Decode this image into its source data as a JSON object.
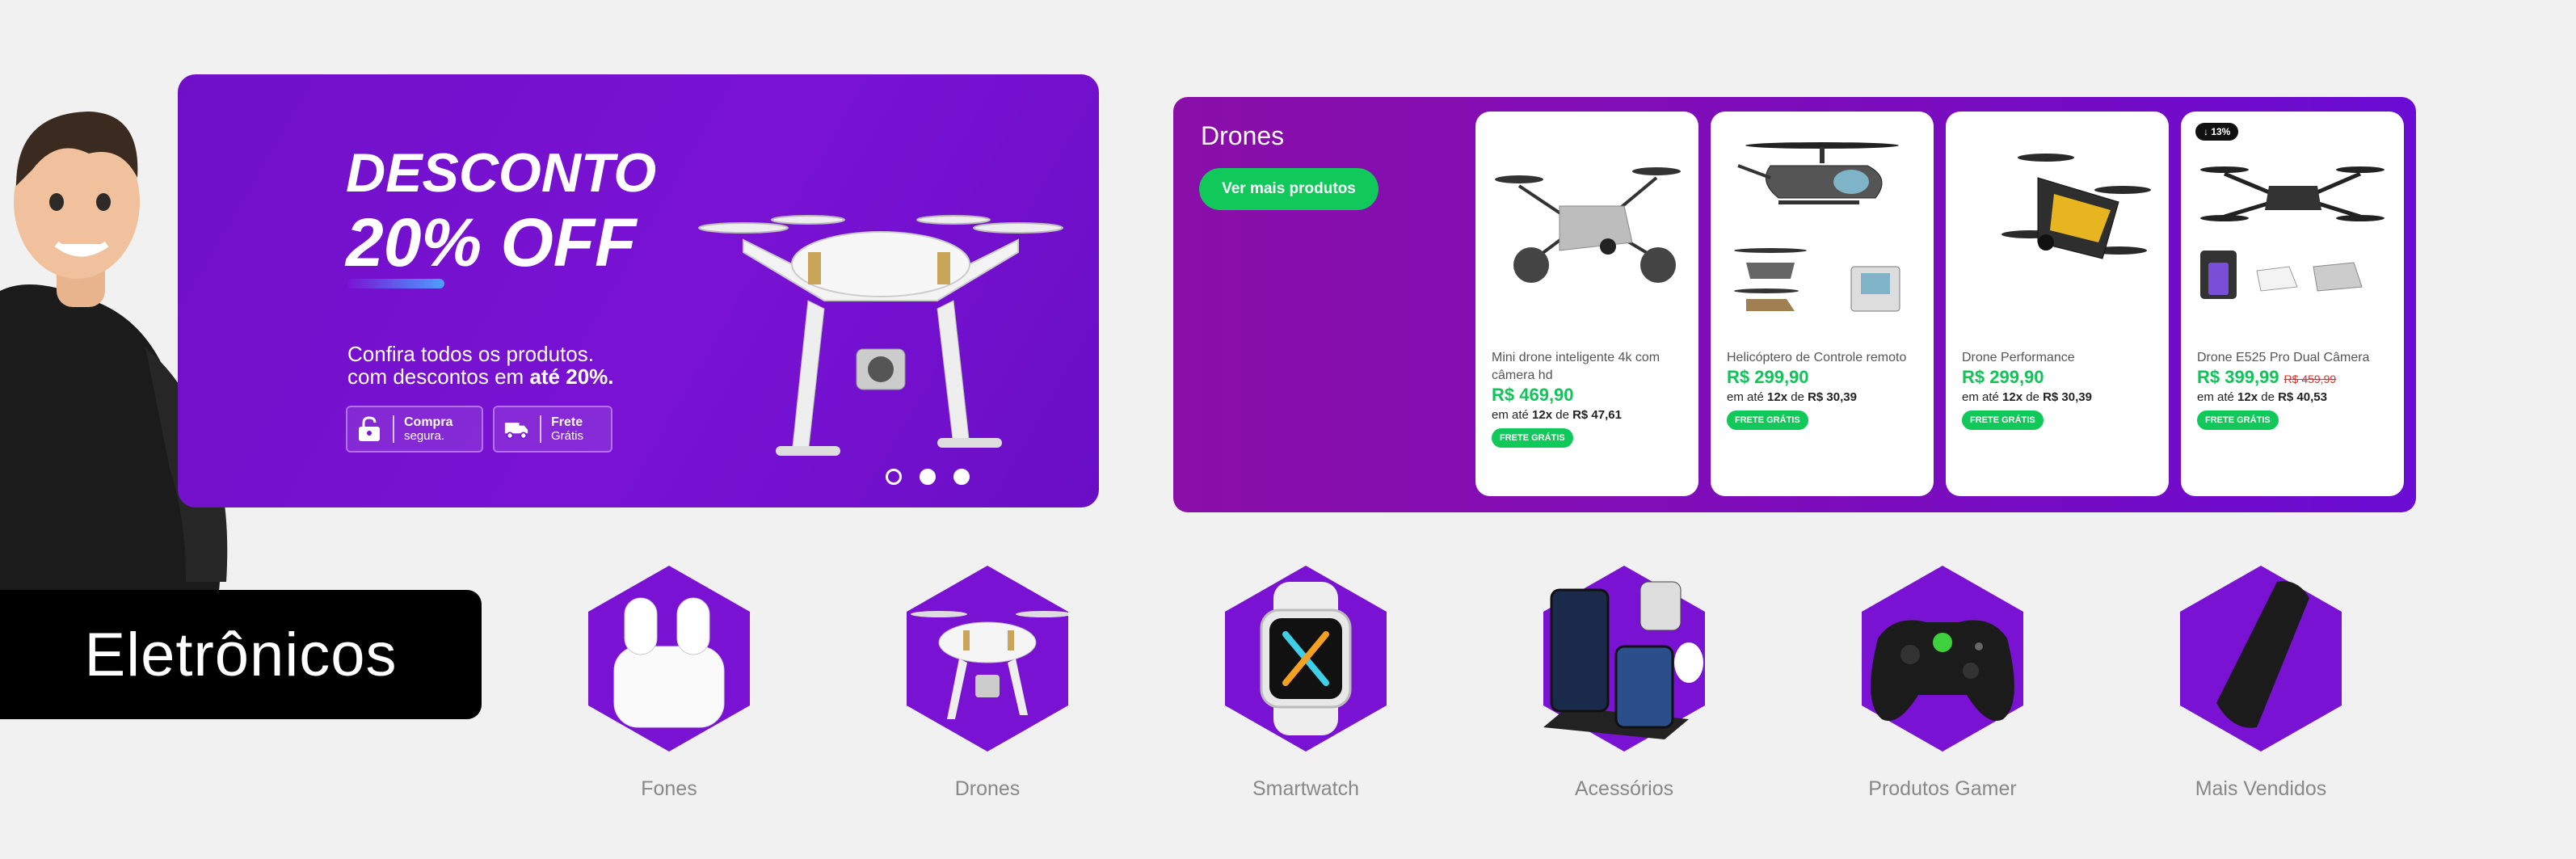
{
  "section": {
    "title": "Eletrônicos"
  },
  "hero": {
    "title_line1": "DESCONTO",
    "title_line2": "20% OFF",
    "subtitle_line1": "Confira todos os produtos.",
    "subtitle_line2_prefix": "com descontos em ",
    "subtitle_line2_bold": "até 20%.",
    "badge1_title": "Compra",
    "badge1_sub": "segura.",
    "badge2_title": "Frete",
    "badge2_sub": "Grátis",
    "carousel_active_index": 0,
    "carousel_count": 3
  },
  "drones": {
    "title": "Drones",
    "more_label": "Ver mais produtos",
    "products": [
      {
        "name": "Mini drone inteligente 4k com câmera hd",
        "price": "R$ 469,90",
        "inst_prefix": "em até",
        "inst_times": "12x",
        "inst_of": "de",
        "inst_value": "R$ 47,61",
        "shipping": "FRETE GRÁTIS",
        "icon": "mini-drone"
      },
      {
        "name": "Helicóptero de Controle remoto",
        "price": "R$ 299,90",
        "inst_prefix": "em até",
        "inst_times": "12x",
        "inst_of": "de",
        "inst_value": "R$ 30,39",
        "shipping": "FRETE GRÁTIS",
        "icon": "helicopter"
      },
      {
        "name": "Drone Performance",
        "price": "R$ 299,90",
        "inst_prefix": "em até",
        "inst_times": "12x",
        "inst_of": "de",
        "inst_value": "R$ 30,39",
        "shipping": "FRETE GRÁTIS",
        "icon": "yellow-drone"
      },
      {
        "name": "Drone E525 Pro Dual Câmera",
        "price": "R$ 399,99",
        "old_price": "R$ 459,99",
        "discount": "↓ 13%",
        "inst_prefix": "em até",
        "inst_times": "12x",
        "inst_of": "de",
        "inst_value": "R$ 40,53",
        "shipping": "FRETE GRÁTIS",
        "icon": "e525-drone-kit"
      }
    ]
  },
  "categories": [
    {
      "label": "Fones",
      "icon": "earbuds"
    },
    {
      "label": "Drones",
      "icon": "drone"
    },
    {
      "label": "Smartwatch",
      "icon": "smartwatch"
    },
    {
      "label": "Acessórios",
      "icon": "charging-dock"
    },
    {
      "label": "Produtos Gamer",
      "icon": "gamepad"
    },
    {
      "label": "Mais Vendidos",
      "icon": "thermos"
    }
  ],
  "colors": {
    "brand_purple": "#7a12d4",
    "accent_green": "#11c85a",
    "sale_red": "#e62b2b"
  }
}
